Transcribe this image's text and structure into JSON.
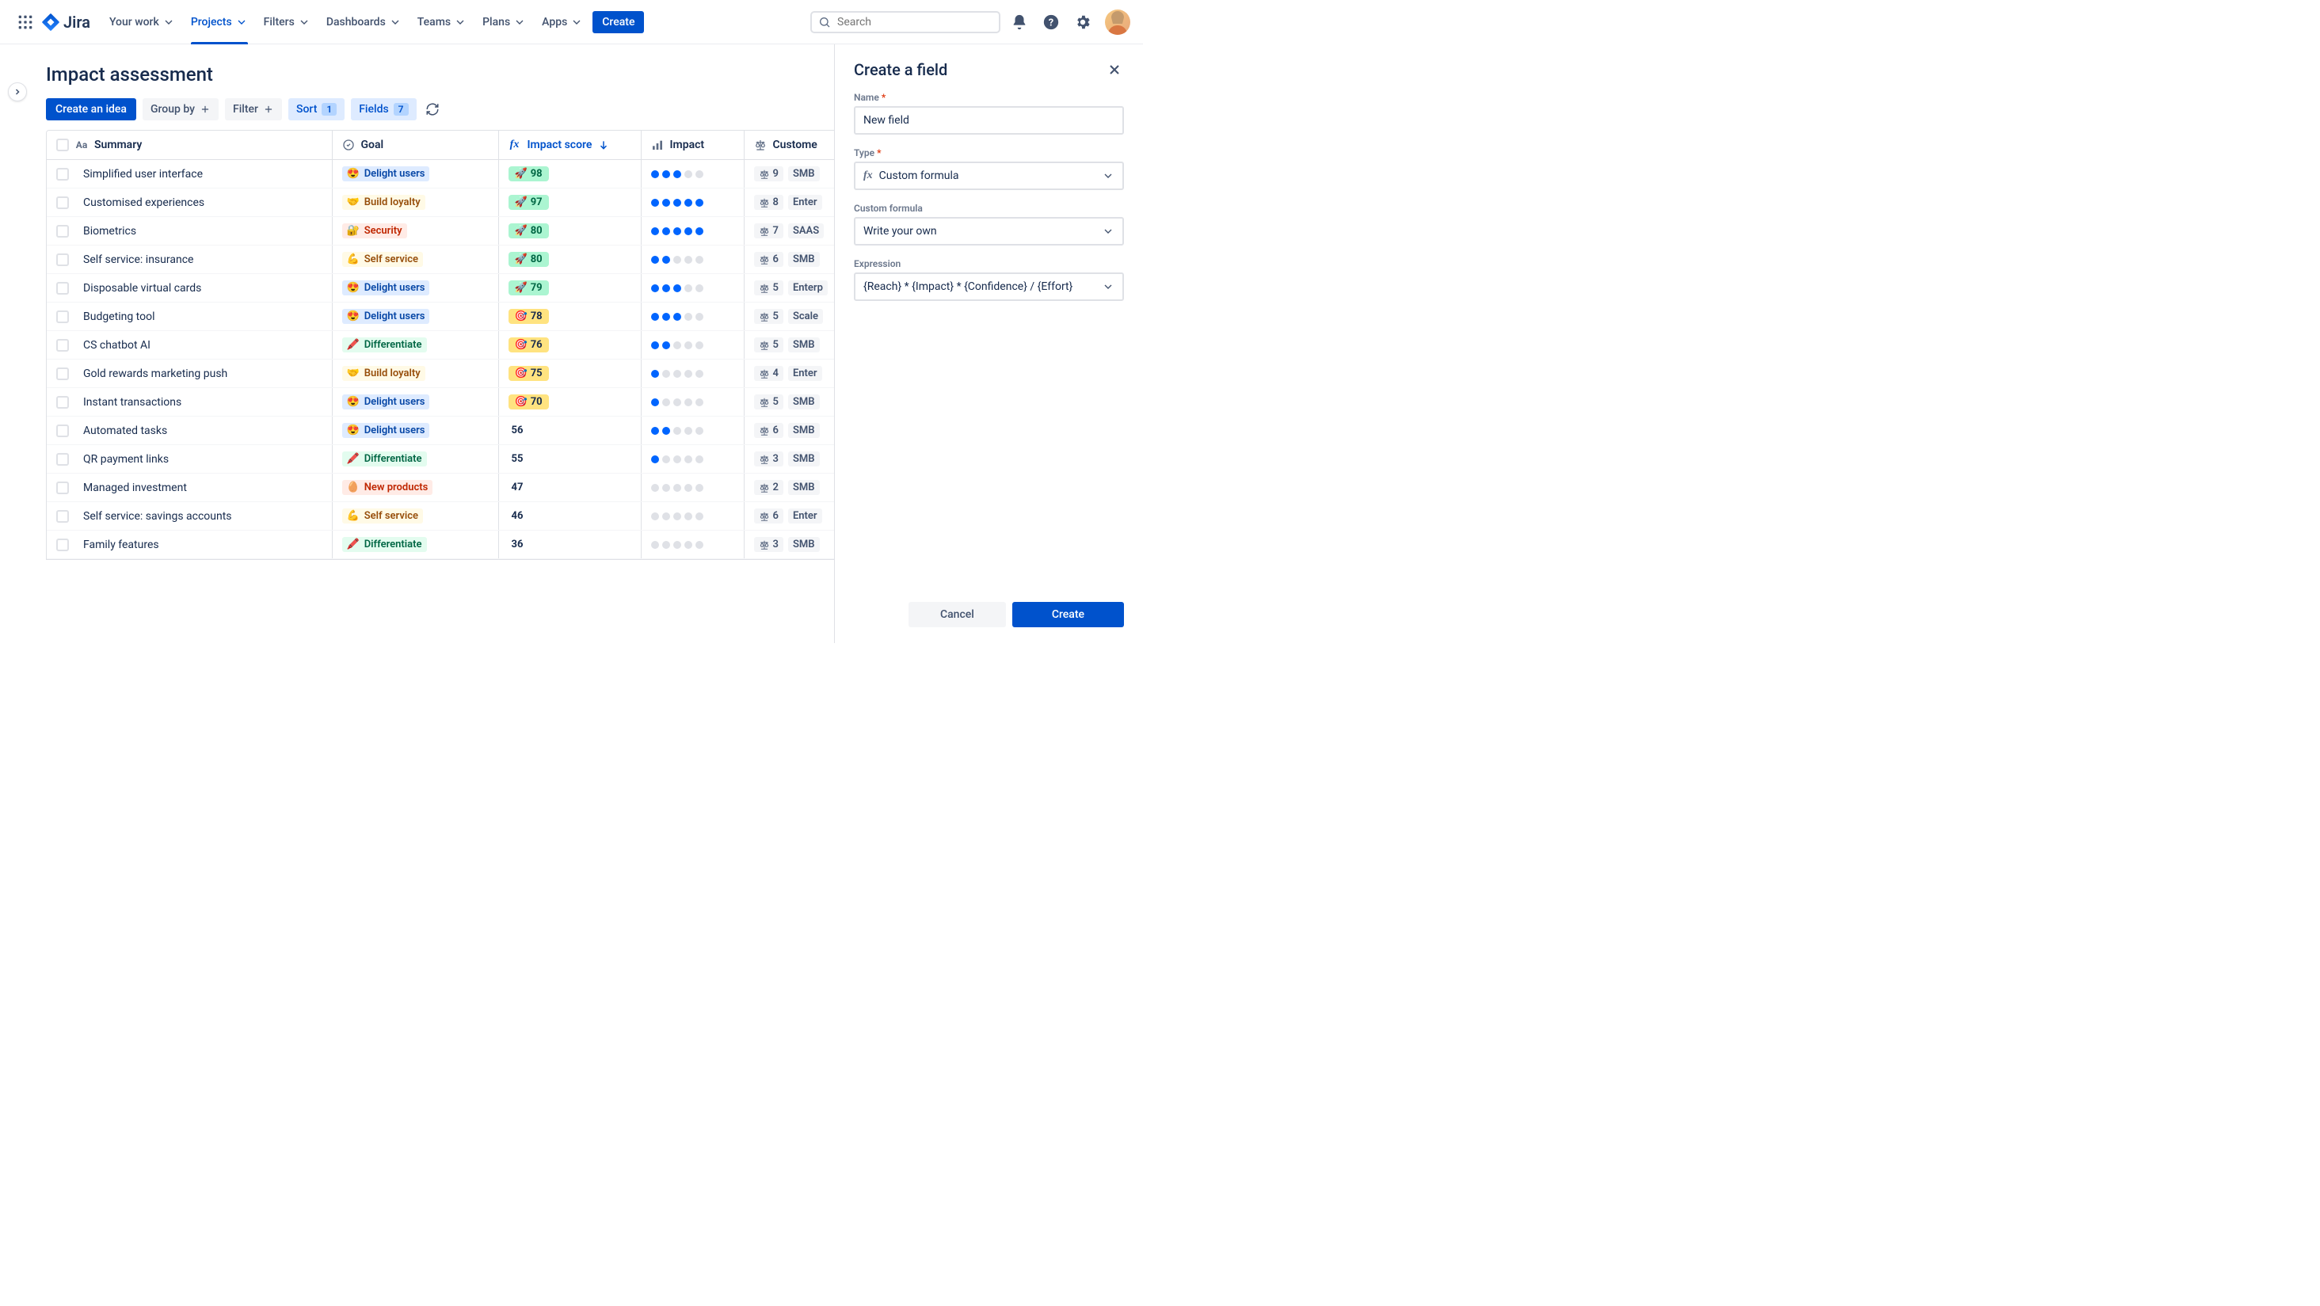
{
  "nav": {
    "logo_text": "Jira",
    "items": [
      "Your work",
      "Projects",
      "Filters",
      "Dashboards",
      "Teams",
      "Plans",
      "Apps"
    ],
    "active_index": 1,
    "create_label": "Create",
    "search_placeholder": "Search"
  },
  "page": {
    "title": "Impact assessment"
  },
  "toolbar": {
    "create_idea": "Create an idea",
    "group_by": "Group by",
    "filter": "Filter",
    "sort": "Sort",
    "sort_count": "1",
    "fields": "Fields",
    "fields_count": "7"
  },
  "columns": {
    "summary": "Summary",
    "goal": "Goal",
    "impact_score": "Impact score",
    "impact": "Impact",
    "customer": "Custome"
  },
  "goals": {
    "delight": {
      "emoji": "😍",
      "label": "Delight users",
      "cls": "goal-delight"
    },
    "loyalty": {
      "emoji": "🤝",
      "label": "Build loyalty",
      "cls": "goal-loyalty"
    },
    "security": {
      "emoji": "🔐",
      "label": "Security",
      "cls": "goal-security"
    },
    "selfservice": {
      "emoji": "💪",
      "label": "Self service",
      "cls": "goal-selfservice"
    },
    "differentiate": {
      "emoji": "🖍️",
      "label": "Differentiate",
      "cls": "goal-differentiate"
    },
    "newproducts": {
      "emoji": "🥚",
      "label": "New products",
      "cls": "goal-newproducts"
    }
  },
  "rows": [
    {
      "summary": "Simplified user interface",
      "goal": "delight",
      "score": 98,
      "score_tier": "high",
      "impact": 3,
      "weight": 9,
      "segment": "SMB"
    },
    {
      "summary": "Customised experiences",
      "goal": "loyalty",
      "score": 97,
      "score_tier": "high",
      "impact": 5,
      "weight": 8,
      "segment": "Enter"
    },
    {
      "summary": "Biometrics",
      "goal": "security",
      "score": 80,
      "score_tier": "high",
      "impact": 5,
      "weight": 7,
      "segment": "SAAS"
    },
    {
      "summary": "Self service: insurance",
      "goal": "selfservice",
      "score": 80,
      "score_tier": "high",
      "impact": 2,
      "weight": 6,
      "segment": "SMB"
    },
    {
      "summary": "Disposable virtual cards",
      "goal": "delight",
      "score": 79,
      "score_tier": "high",
      "impact": 3,
      "weight": 5,
      "segment": "Enterp"
    },
    {
      "summary": "Budgeting tool",
      "goal": "delight",
      "score": 78,
      "score_tier": "mid",
      "impact": 3,
      "weight": 5,
      "segment": "Scale"
    },
    {
      "summary": "CS chatbot AI",
      "goal": "differentiate",
      "score": 76,
      "score_tier": "mid",
      "impact": 2,
      "weight": 5,
      "segment": "SMB"
    },
    {
      "summary": "Gold rewards marketing push",
      "goal": "loyalty",
      "score": 75,
      "score_tier": "mid",
      "impact": 1,
      "weight": 4,
      "segment": "Enter"
    },
    {
      "summary": "Instant transactions",
      "goal": "delight",
      "score": 70,
      "score_tier": "mid",
      "impact": 1,
      "weight": 5,
      "segment": "SMB"
    },
    {
      "summary": "Automated tasks",
      "goal": "delight",
      "score": 56,
      "score_tier": "low",
      "impact": 2,
      "weight": 6,
      "segment": "SMB"
    },
    {
      "summary": "QR payment links",
      "goal": "differentiate",
      "score": 55,
      "score_tier": "low",
      "impact": 1,
      "weight": 3,
      "segment": "SMB"
    },
    {
      "summary": "Managed investment",
      "goal": "newproducts",
      "score": 47,
      "score_tier": "low",
      "impact": 0,
      "weight": 2,
      "segment": "SMB"
    },
    {
      "summary": "Self service: savings accounts",
      "goal": "selfservice",
      "score": 46,
      "score_tier": "low",
      "impact": 0,
      "weight": 6,
      "segment": "Enter"
    },
    {
      "summary": "Family features",
      "goal": "differentiate",
      "score": 36,
      "score_tier": "low",
      "impact": 0,
      "weight": 3,
      "segment": "SMB"
    }
  ],
  "panel": {
    "title": "Create a field",
    "name_label": "Name",
    "name_value": "New field",
    "type_label": "Type",
    "type_value": "Custom formula",
    "formula_label": "Custom formula",
    "formula_value": "Write your own",
    "expression_label": "Expression",
    "expression_value": "{Reach} * {Impact} * {Confidence} / {Effort}",
    "cancel": "Cancel",
    "create": "Create"
  }
}
